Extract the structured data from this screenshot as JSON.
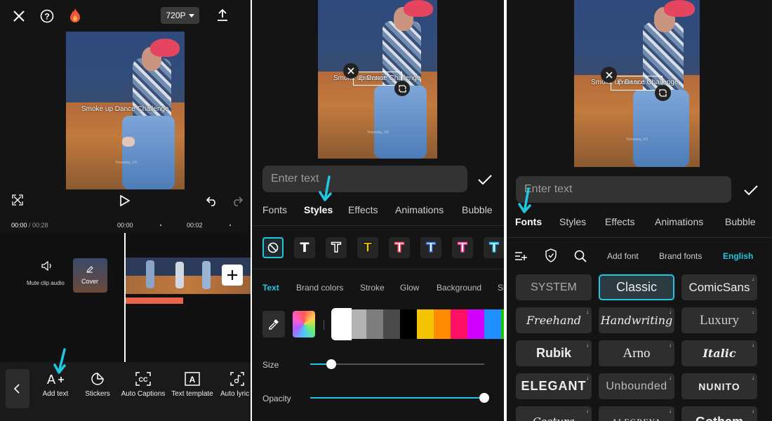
{
  "panel1": {
    "resolution": "720P",
    "caption": "Smoke up Dance Challenge",
    "watermark": "Yoonsday_XX",
    "time_current": "00:00",
    "time_total": " / 00:28",
    "tick_a": "00:00",
    "tick_b": "00:02",
    "mute_label": "Mute clip audio",
    "cover_label": "Cover",
    "tools": [
      {
        "label": "Add text",
        "icon": "add-text-icon"
      },
      {
        "label": "Stickers",
        "icon": "sticker-icon"
      },
      {
        "label": "Auto Captions",
        "icon": "auto-captions-icon"
      },
      {
        "label": "Text template",
        "icon": "text-template-icon"
      },
      {
        "label": "Auto lyric",
        "icon": "auto-lyrics-icon"
      }
    ]
  },
  "panel2": {
    "caption": "Smoke up Dance Challenge",
    "caption_overlay": "Enter text",
    "watermark": "Yoonsday_XX",
    "input_placeholder": "Enter text",
    "tabs": [
      "Fonts",
      "Styles",
      "Effects",
      "Animations",
      "Bubble"
    ],
    "active_tab": "Styles",
    "style_glyph": "T",
    "subtabs": [
      "Text",
      "Brand colors",
      "Stroke",
      "Glow",
      "Background",
      "Sh"
    ],
    "swatches": [
      "#ffffff",
      "#b3b3b3",
      "#7d7d7d",
      "#4a4a4a",
      "#000000",
      "#f5c400",
      "#ff8a00",
      "#ff0f66",
      "#d100ff",
      "#1e90ff",
      "#19c700"
    ],
    "size_label": "Size",
    "size_value": 0.12,
    "opacity_label": "Opacity",
    "opacity_value": 1.0
  },
  "panel3": {
    "caption": "Smoke up Dance Challenge",
    "caption_overlay": "Enter text",
    "watermark": "Yoonsday_XX",
    "input_placeholder": "Enter text",
    "tabs": [
      "Fonts",
      "Styles",
      "Effects",
      "Animations",
      "Bubble"
    ],
    "active_tab": "Fonts",
    "font_tools": [
      "Add font",
      "Brand fonts",
      "English"
    ],
    "fonts": [
      [
        "SYSTEM",
        "Classic",
        "ComicSans"
      ],
      [
        "Freehand",
        "Handwriting",
        "Luxury"
      ],
      [
        "Rubik",
        "Arno",
        "Italic"
      ],
      [
        "ELEGANT",
        "Unbounded",
        "NUNITO"
      ],
      [
        "Costura",
        "ALEGREYA",
        "Gotham"
      ]
    ],
    "selected_font": "Classic"
  },
  "colors": {
    "accent": "#1fc8e1",
    "panel_bg": "#141414",
    "cell_bg": "#2e2e2e"
  }
}
